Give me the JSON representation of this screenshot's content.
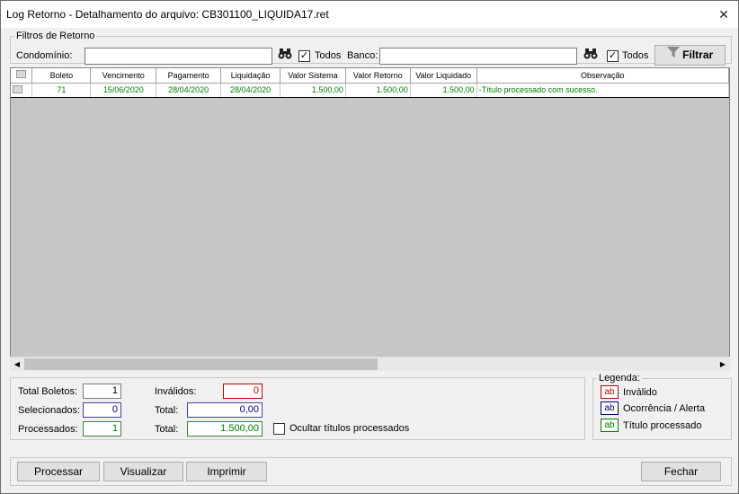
{
  "window": {
    "title": "Log Retorno - Detalhamento do arquivo: CB301100_LIQUIDA17.ret",
    "close_glyph": "✕"
  },
  "filtros": {
    "legend": "Filtros de Retorno",
    "condominio_label": "Condomínio:",
    "condominio_value": "",
    "todos1_label": "Todos",
    "banco_label": "Banco:",
    "banco_value": "",
    "todos2_label": "Todos",
    "filtrar_label": "Filtrar",
    "check_glyph": "✓"
  },
  "grid": {
    "columns": [
      "Boleto",
      "Vencimento",
      "Pagamento",
      "Liquidação",
      "Valor Sistema",
      "Valor Retorno",
      "Valor Liquidado",
      "Observação"
    ],
    "rows": [
      {
        "boleto": "71",
        "vencimento": "15/06/2020",
        "pagamento": "28/04/2020",
        "liquidacao": "28/04/2020",
        "valor_sistema": "1.500,00",
        "valor_retorno": "1.500,00",
        "valor_liquidado": "1.500,00",
        "observacao": "-Título processado com sucesso."
      }
    ]
  },
  "totals": {
    "total_boletos_label": "Total Boletos:",
    "total_boletos": "1",
    "invalidos_label": "Inválidos:",
    "invalidos": "0",
    "selecionados_label": "Selecionados:",
    "selecionados": "0",
    "total1_label": "Total:",
    "total1": "0,00",
    "processados_label": "Processados:",
    "processados": "1",
    "total2_label": "Total:",
    "total2": "1.500,00",
    "ocultar_label": "Ocultar títulos processados"
  },
  "legenda": {
    "legend": "Legenda:",
    "swatch": "ab",
    "items": [
      "Inválido",
      "Ocorrência / Alerta",
      "Título processado"
    ],
    "colors": {
      "invalido": "#c00000",
      "alerta": "#000080",
      "processado": "#008000"
    }
  },
  "footer": {
    "processar": "Processar",
    "visualizar": "Visualizar",
    "imprimir": "Imprimir",
    "fechar": "Fechar"
  }
}
